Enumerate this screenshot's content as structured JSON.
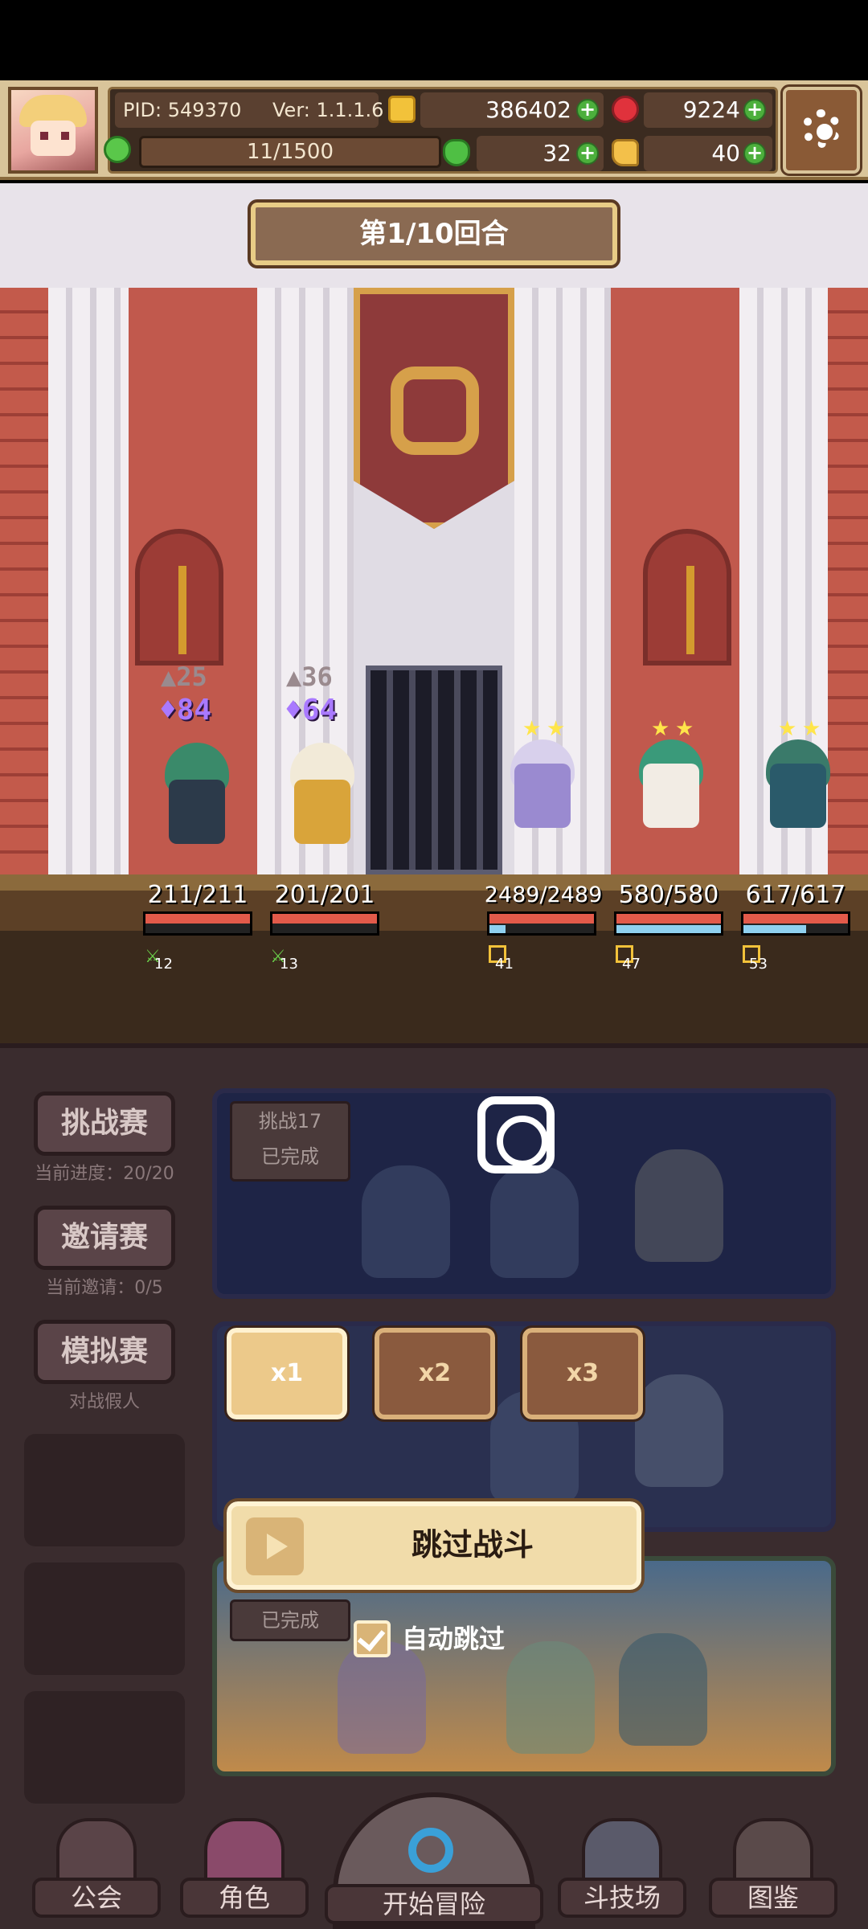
{
  "header": {
    "pid": "PID: 549370",
    "version": "Ver: 1.1.1.6",
    "gold": "386402",
    "gems": "9224",
    "stamina": "11/1500",
    "clover": "32",
    "hand": "40"
  },
  "battle": {
    "round": "第1/10回合",
    "allies": [
      {
        "shield": "25",
        "attack": "84",
        "hp": "211/211",
        "level": "12",
        "hp_ratio": 1.0,
        "mp_ratio": 0.0
      },
      {
        "shield": "36",
        "attack": "64",
        "hp": "201/201",
        "level": "13",
        "hp_ratio": 1.0,
        "mp_ratio": 0.0
      }
    ],
    "enemies": [
      {
        "hp": "2489/2489",
        "level": "41",
        "hp_ratio": 1.0,
        "mp_ratio": 0.15
      },
      {
        "hp": "580/580",
        "level": "47",
        "hp_ratio": 1.0,
        "mp_ratio": 1.0
      },
      {
        "hp": "617/617",
        "level": "53",
        "hp_ratio": 1.0,
        "mp_ratio": 0.6
      }
    ]
  },
  "sidebar": {
    "challenge": {
      "label": "挑战赛",
      "sub": "当前进度：20/20"
    },
    "invite": {
      "label": "邀请赛",
      "sub": "当前邀请：0/5"
    },
    "mock": {
      "label": "模拟赛",
      "sub": "对战假人"
    }
  },
  "cards": {
    "card1_tag_title": "挑战17",
    "card1_tag_status": "已完成",
    "card3_tag": "已完成"
  },
  "controls": {
    "speed": [
      "x1",
      "x2",
      "x3"
    ],
    "skip_label": "跳过战斗",
    "auto_skip_label": "自动跳过"
  },
  "nav": {
    "guild": "公会",
    "character": "角色",
    "adventure": "开始冒险",
    "arena": "斗技场",
    "codex": "图鉴"
  },
  "colors": {
    "hp": "#e25a4a",
    "mp": "#8fd0ef",
    "attack": "#a979ff"
  }
}
